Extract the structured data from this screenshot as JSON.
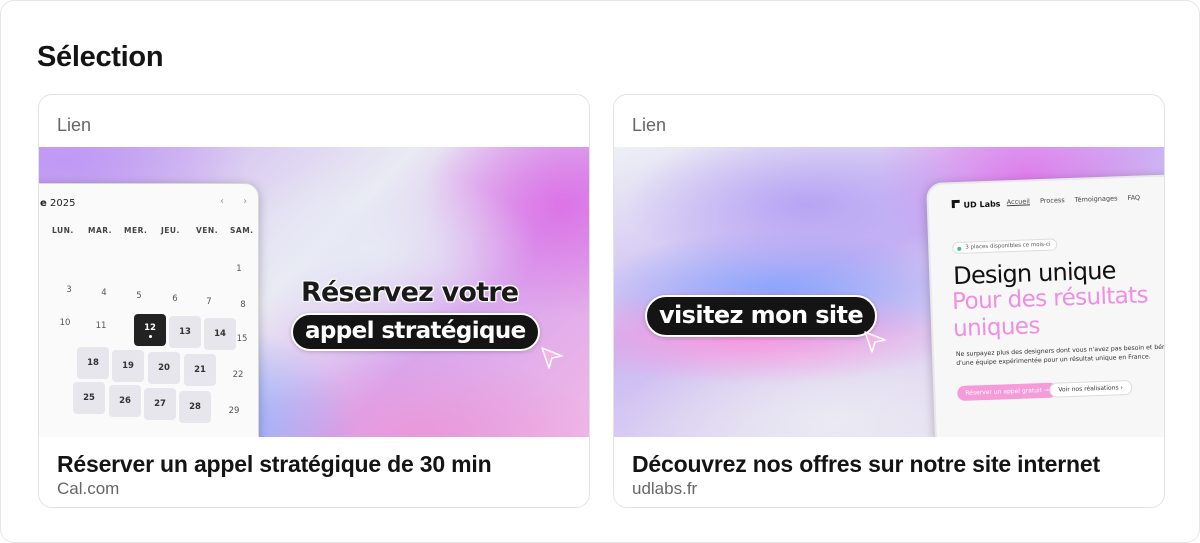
{
  "section": {
    "title": "Sélection"
  },
  "cards": [
    {
      "kind": "Lien",
      "title": "Réserver un appel stratégique de 30 min",
      "domain": "Cal.com",
      "image": {
        "headline": "Réservez votre",
        "pill": "appel stratégique",
        "calendar": {
          "month_suffix": "e",
          "year": "2025",
          "nav": "‹ ›",
          "weekdays": [
            "LUN.",
            "MAR.",
            "MER.",
            "JEU.",
            "VEN.",
            "SAM."
          ],
          "plain_days": [
            "1",
            "3",
            "4",
            "5",
            "6",
            "7",
            "8",
            "10",
            "11",
            "15",
            "22",
            "29"
          ],
          "available_days": [
            "12",
            "13",
            "14",
            "18",
            "19",
            "20",
            "21",
            "25",
            "26",
            "27",
            "28"
          ],
          "selected_day": "12"
        }
      }
    },
    {
      "kind": "Lien",
      "title": "Découvrez nos offres sur notre site internet",
      "domain": "udlabs.fr",
      "image": {
        "pill": "visitez mon site",
        "site": {
          "logo": "UD Labs",
          "nav": [
            "Accueil",
            "Process",
            "Témoignages",
            "FAQ"
          ],
          "badge": "3 places disponibles ce mois-ci",
          "h1": "Design unique",
          "h2": "Pour des résultats uniques",
          "paragraph": "Ne surpayez plus des designers dont vous n'avez pas besoin et bénéficiez d'une équipe expérimentée pour un résultat unique en France.",
          "cta_primary": "Réserver un appel gratuit →",
          "cta_secondary": "Voir nos réalisations ›"
        }
      }
    }
  ],
  "colors": {
    "accent_pink": "#f08ee0",
    "pill_dark": "#141414"
  }
}
